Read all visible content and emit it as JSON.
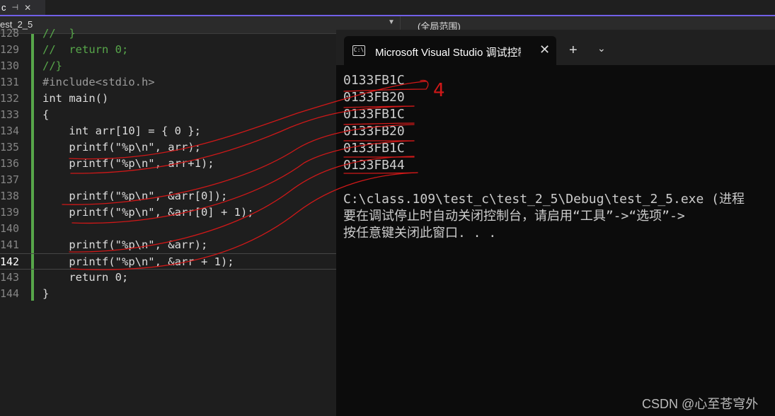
{
  "ide": {
    "tab_label": "c",
    "pin_icon": "pin-icon",
    "file_dropdown": "est_2_5",
    "scope_dropdown": "(全局范围)",
    "lines": [
      {
        "n": "128",
        "code": "//  }"
      },
      {
        "n": "129",
        "code": "//  return 0;"
      },
      {
        "n": "130",
        "code": "//}"
      },
      {
        "n": "131",
        "code": "#include<stdio.h>"
      },
      {
        "n": "132",
        "code": "int main()"
      },
      {
        "n": "133",
        "code": "{"
      },
      {
        "n": "134",
        "code": "    int arr[10] = { 0 };"
      },
      {
        "n": "135",
        "code": "    printf(\"%p\\n\", arr);"
      },
      {
        "n": "136",
        "code": "    printf(\"%p\\n\", arr+1);"
      },
      {
        "n": "137",
        "code": ""
      },
      {
        "n": "138",
        "code": "    printf(\"%p\\n\", &arr[0]);"
      },
      {
        "n": "139",
        "code": "    printf(\"%p\\n\", &arr[0] + 1);"
      },
      {
        "n": "140",
        "code": ""
      },
      {
        "n": "141",
        "code": "    printf(\"%p\\n\", &arr);"
      },
      {
        "n": "142",
        "code": "    printf(\"%p\\n\", &arr + 1);"
      },
      {
        "n": "143",
        "code": "    return 0;"
      },
      {
        "n": "144",
        "code": "}"
      }
    ]
  },
  "terminal": {
    "title": "Microsoft Visual Studio 调试控制台",
    "output": [
      "0133FB1C",
      "0133FB20",
      "0133FB1C",
      "0133FB20",
      "0133FB1C",
      "0133FB44"
    ],
    "message1": "C:\\class.109\\test_c\\test_2_5\\Debug\\test_2_5.exe (进程",
    "message2": "要在调试停止时自动关闭控制台，请启用“工具”->“选项”->",
    "message3": "按任意键关闭此窗口. . .",
    "annotation": "4"
  },
  "watermark": "CSDN @心至苍穹外",
  "accent": "#7160e8"
}
